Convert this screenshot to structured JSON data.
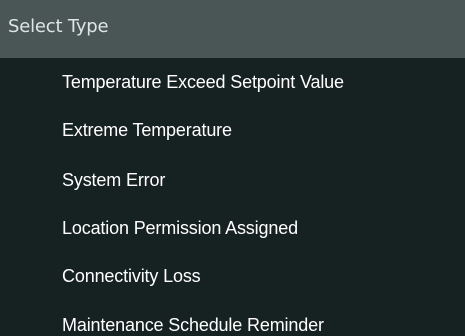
{
  "dropdown": {
    "placeholder": "Select Type",
    "options": [
      {
        "label": "Temperature Exceed Setpoint Value"
      },
      {
        "label": "Extreme Temperature"
      },
      {
        "label": "System Error"
      },
      {
        "label": "Location Permission Assigned"
      },
      {
        "label": "Connectivity Loss"
      },
      {
        "label": "Maintenance Schedule Reminder"
      }
    ]
  },
  "colors": {
    "list_background": "#162121",
    "header_background": "#4a5656",
    "header_text": "#dfe5e5",
    "option_text": "#ffffff"
  }
}
